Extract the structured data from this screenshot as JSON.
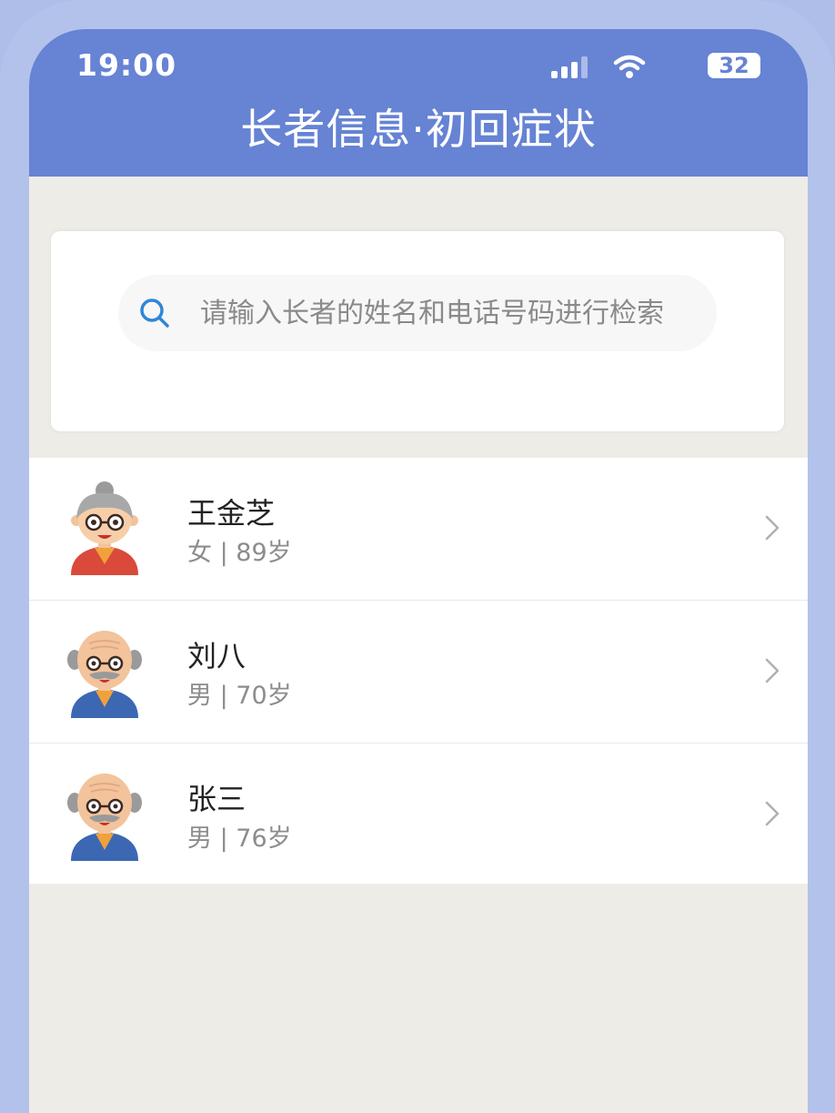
{
  "status": {
    "time": "19:00",
    "battery": "32"
  },
  "header": {
    "title": "长者信息·初回症状"
  },
  "search": {
    "placeholder": "请输入长者的姓名和电话号码进行检索"
  },
  "elders": [
    {
      "name": "王金芝",
      "meta": "女 | 89岁",
      "avatar": "grandmother-avatar"
    },
    {
      "name": "刘八",
      "meta": "男 | 70岁",
      "avatar": "grandfather-avatar"
    },
    {
      "name": "张三",
      "meta": "男 | 76岁",
      "avatar": "grandfather-avatar"
    }
  ],
  "colors": {
    "header": "#6683d4",
    "background": "#eeece6",
    "frame": "#b3c2ea",
    "search_icon": "#2f86d8"
  }
}
